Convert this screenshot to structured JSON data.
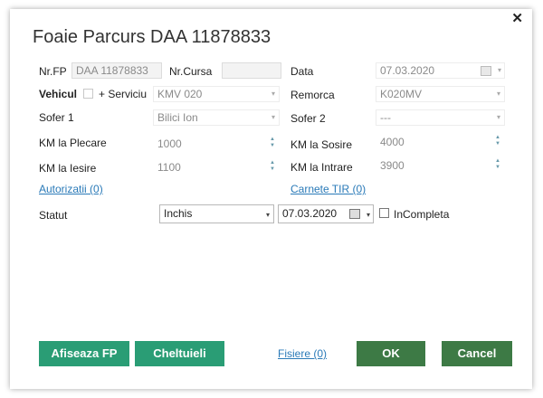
{
  "dialog": {
    "title": "Foaie Parcurs DAA 11878833",
    "close_glyph": "✕"
  },
  "fields": {
    "nrfp_label": "Nr.FP",
    "nrfp_value": "DAA 11878833",
    "nrcursa_label": "Nr.Cursa",
    "nrcursa_value": "",
    "data_label": "Data",
    "data_value": "07.03.2020",
    "vehicul_label": "Vehicul",
    "serviciu_label": "+ Serviciu",
    "vehicul_value": "KMV 020",
    "remorca_label": "Remorca",
    "remorca_value": "K020MV",
    "sofer1_label": "Sofer 1",
    "sofer1_value": "Bilici Ion",
    "sofer2_label": "Sofer 2",
    "sofer2_value": "---",
    "km_plecare_label": "KM la Plecare",
    "km_plecare_value": "1000",
    "km_sosire_label": "KM la Sosire",
    "km_sosire_value": "4000",
    "km_iesire_label": "KM la Iesire",
    "km_iesire_value": "1100",
    "km_intrare_label": "KM la Intrare",
    "km_intrare_value": "3900",
    "autorizatii_link": "Autorizatii (0)",
    "carnete_link": "Carnete TIR (0)",
    "statut_label": "Statut",
    "statut_value": "Inchis",
    "statut_date_value": "07.03.2020",
    "incompleta_label": "InCompleta"
  },
  "buttons": {
    "afiseaza_label": "Afiseaza FP",
    "cheltuieli_label": "Cheltuieli",
    "fisiere_link": "Fisiere (0)",
    "ok_label": "OK",
    "cancel_label": "Cancel"
  },
  "colors": {
    "teal_button": "#2a9d75",
    "green_button": "#3d7a45",
    "link": "#2a7ab8"
  },
  "icons": {
    "dropdown": "▾",
    "spin_up": "▲",
    "spin_down": "▼"
  }
}
